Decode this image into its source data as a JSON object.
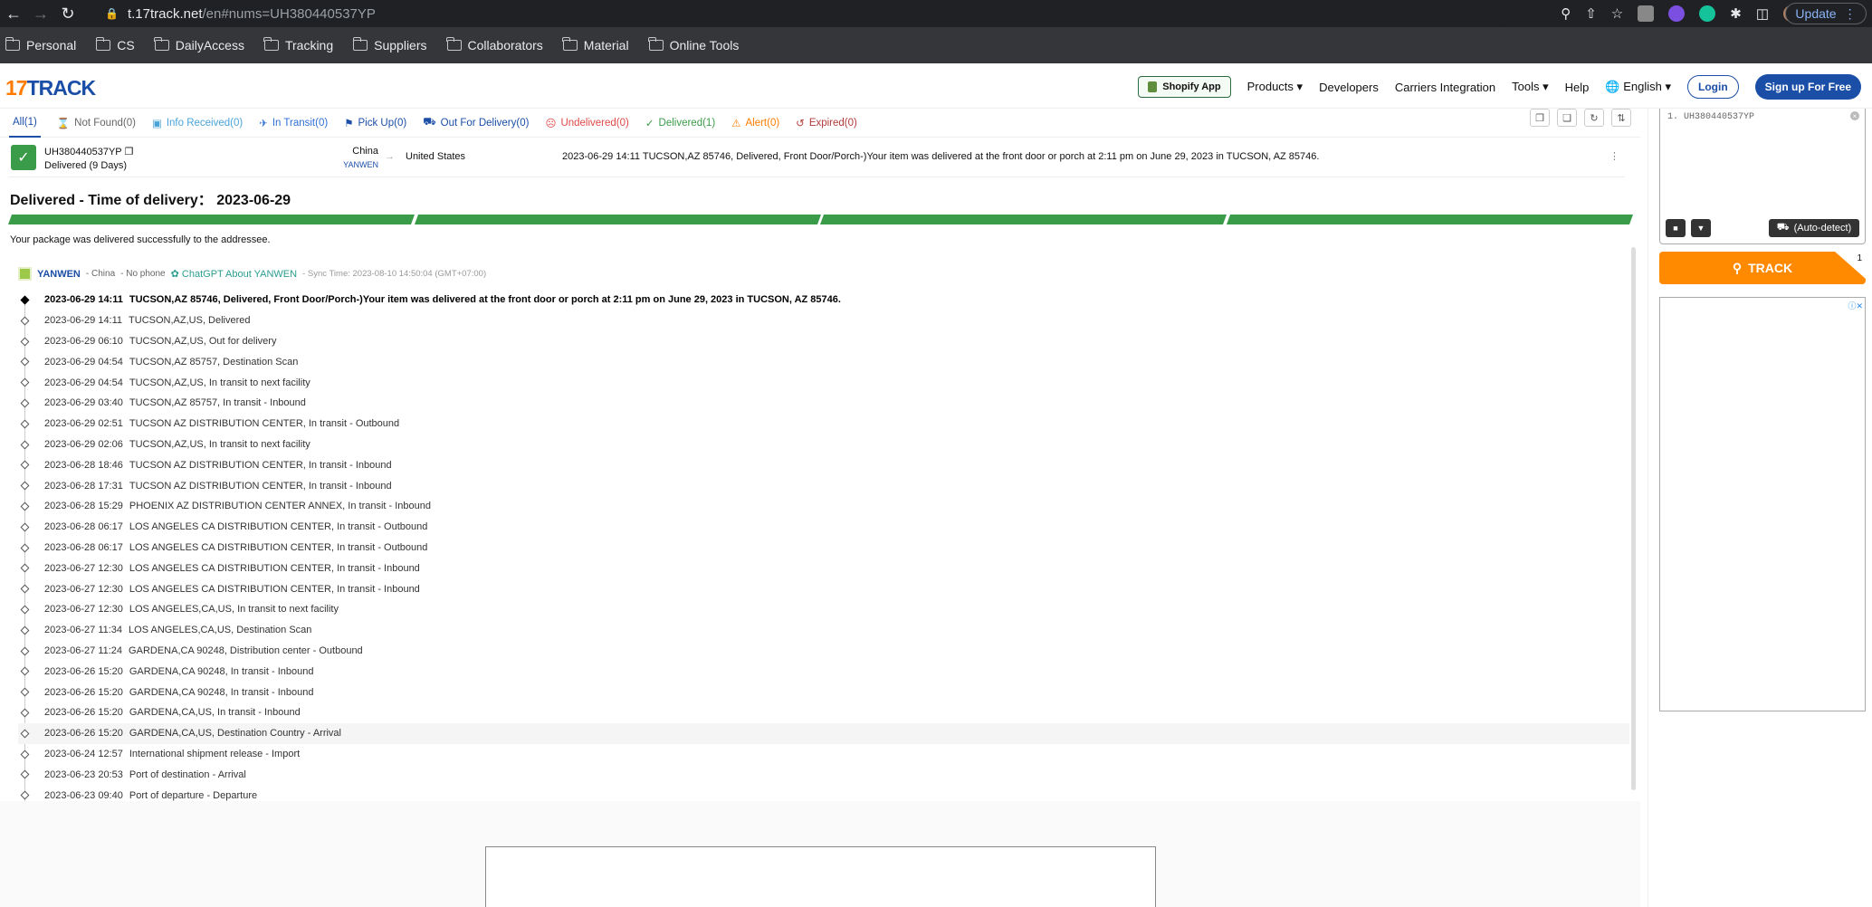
{
  "browser": {
    "url_host": "t.17track.net",
    "url_path": "/en#nums=UH380440537YP",
    "update_label": "Update",
    "bookmarks": [
      "Personal",
      "CS",
      "DailyAccess",
      "Tracking",
      "Suppliers",
      "Collaborators",
      "Material",
      "Online Tools"
    ]
  },
  "header": {
    "logo_a": "17",
    "logo_b": "TRACK",
    "shopify": "Shopify App",
    "nav": [
      "Products",
      "Developers",
      "Carriers Integration",
      "Tools",
      "Help",
      "English"
    ],
    "login": "Login",
    "signup": "Sign up For Free"
  },
  "tabs": [
    {
      "label": "All(1)",
      "color": "#1b4ea7"
    },
    {
      "label": "Not Found(0)",
      "color": "#666666"
    },
    {
      "label": "Info Received(0)",
      "color": "#4aa3d8"
    },
    {
      "label": "In Transit(0)",
      "color": "#2f6fd6"
    },
    {
      "label": "Pick Up(0)",
      "color": "#1b4ea7"
    },
    {
      "label": "Out For Delivery(0)",
      "color": "#1b4ea7"
    },
    {
      "label": "Undelivered(0)",
      "color": "#e04848"
    },
    {
      "label": "Delivered(1)",
      "color": "#3a9b49"
    },
    {
      "label": "Alert(0)",
      "color": "#ff7b00"
    },
    {
      "label": "Expired(0)",
      "color": "#b23b3b"
    }
  ],
  "shipment": {
    "tracking_number": "UH380440537YP",
    "delivered_days": "Delivered (9 Days)",
    "origin_country": "China",
    "origin_carrier": "YANWEN",
    "dest_country": "United States",
    "latest_event": "2023-06-29 14:11  TUCSON,AZ 85746, Delivered, Front Door/Porch-)Your item was delivered at the front door or porch at 2:11 pm on June 29, 2023 in TUCSON, AZ 85746.",
    "status_title": "Delivered - Time of delivery： 2023-06-29",
    "status_desc": "Your package was delivered successfully to the addressee.",
    "progress_percent": 100
  },
  "carrier": {
    "name": "YANWEN",
    "country": "- China",
    "phone": "- No phone",
    "gpt": "ChatGPT About YANWEN",
    "sync": "- Sync Time: 2023-08-10 14:50:04 (GMT+07:00)"
  },
  "events": [
    {
      "time": "2023-06-29 14:11",
      "desc": "TUCSON,AZ 85746, Delivered, Front Door/Porch-)Your item was delivered at the front door or porch at 2:11 pm on June 29, 2023 in TUCSON, AZ 85746."
    },
    {
      "time": "2023-06-29 14:11",
      "desc": "TUCSON,AZ,US, Delivered"
    },
    {
      "time": "2023-06-29 06:10",
      "desc": "TUCSON,AZ,US, Out for delivery"
    },
    {
      "time": "2023-06-29 04:54",
      "desc": "TUCSON,AZ 85757, Destination Scan"
    },
    {
      "time": "2023-06-29 04:54",
      "desc": "TUCSON,AZ,US, In transit to next facility"
    },
    {
      "time": "2023-06-29 03:40",
      "desc": "TUCSON,AZ 85757, In transit - Inbound"
    },
    {
      "time": "2023-06-29 02:51",
      "desc": "TUCSON AZ DISTRIBUTION CENTER, In transit - Outbound"
    },
    {
      "time": "2023-06-29 02:06",
      "desc": "TUCSON,AZ,US, In transit to next facility"
    },
    {
      "time": "2023-06-28 18:46",
      "desc": "TUCSON AZ DISTRIBUTION CENTER, In transit - Inbound"
    },
    {
      "time": "2023-06-28 17:31",
      "desc": "TUCSON AZ DISTRIBUTION CENTER, In transit - Inbound"
    },
    {
      "time": "2023-06-28 15:29",
      "desc": "PHOENIX AZ DISTRIBUTION CENTER ANNEX, In transit - Inbound"
    },
    {
      "time": "2023-06-28 06:17",
      "desc": "LOS ANGELES CA DISTRIBUTION CENTER, In transit - Outbound"
    },
    {
      "time": "2023-06-28 06:17",
      "desc": "LOS ANGELES CA DISTRIBUTION CENTER, In transit - Outbound"
    },
    {
      "time": "2023-06-27 12:30",
      "desc": "LOS ANGELES CA DISTRIBUTION CENTER, In transit - Inbound"
    },
    {
      "time": "2023-06-27 12:30",
      "desc": "LOS ANGELES CA DISTRIBUTION CENTER, In transit - Inbound"
    },
    {
      "time": "2023-06-27 12:30",
      "desc": "LOS ANGELES,CA,US, In transit to next facility"
    },
    {
      "time": "2023-06-27 11:34",
      "desc": "LOS ANGELES,CA,US, Destination Scan"
    },
    {
      "time": "2023-06-27 11:24",
      "desc": "GARDENA,CA 90248, Distribution center - Outbound"
    },
    {
      "time": "2023-06-26 15:20",
      "desc": "GARDENA,CA 90248, In transit - Inbound"
    },
    {
      "time": "2023-06-26 15:20",
      "desc": "GARDENA,CA 90248, In transit - Inbound"
    },
    {
      "time": "2023-06-26 15:20",
      "desc": "GARDENA,CA,US, In transit - Inbound"
    },
    {
      "time": "2023-06-26 15:20",
      "desc": "GARDENA,CA,US, Destination Country - Arrival"
    },
    {
      "time": "2023-06-24 12:57",
      "desc": "International shipment release - Import"
    },
    {
      "time": "2023-06-23 20:53",
      "desc": "Port of destination - Arrival"
    },
    {
      "time": "2023-06-23 09:40",
      "desc": "Port of departure - Departure"
    }
  ],
  "sidebar": {
    "input_value": "1. UH380440537YP",
    "autodetect": "(Auto-detect)",
    "track_label": "TRACK",
    "track_count": "1"
  }
}
